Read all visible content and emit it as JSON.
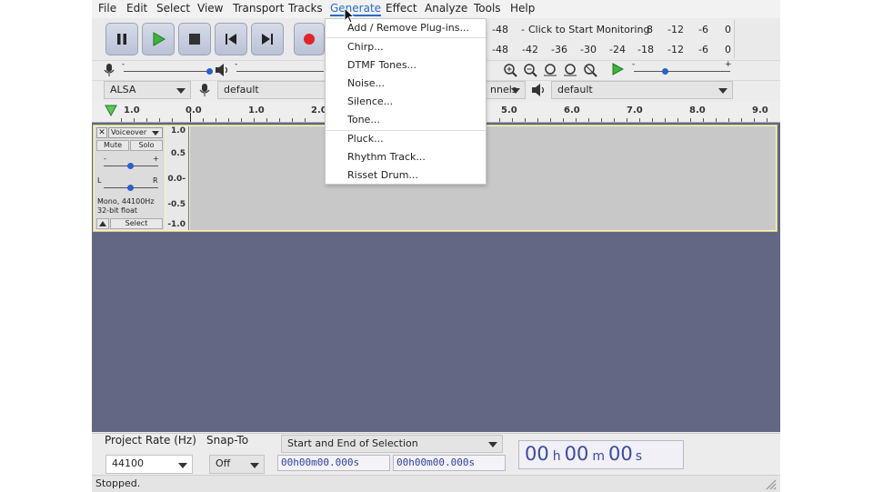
{
  "menubar": {
    "items": [
      "File",
      "Edit",
      "Select",
      "View",
      "Transport",
      "Tracks",
      "Generate",
      "Effect",
      "Analyze",
      "Tools",
      "Help"
    ],
    "active": "Generate"
  },
  "meters": {
    "record_scale": [
      "-48",
      "Click to Start Monitoring",
      "8",
      "-12",
      "-6",
      "0"
    ],
    "play_scale": [
      "-48",
      "-42",
      "-36",
      "-30",
      "-24",
      "-18",
      "-12",
      "-6",
      "0"
    ]
  },
  "device": {
    "host": "ALSA",
    "record_device": "default",
    "channels": "nnels",
    "playback_device": "default"
  },
  "ruler": {
    "labels": [
      "1.0",
      "0.0",
      "1.0",
      "2.0",
      "5.0",
      "6.0",
      "7.0",
      "8.0",
      "9.0"
    ]
  },
  "track": {
    "name": "Voiceover",
    "mute": "Mute",
    "solo": "Solo",
    "gain_min": "-",
    "gain_max": "+",
    "pan_left": "L",
    "pan_right": "R",
    "info_line1": "Mono, 44100Hz",
    "info_line2": "32-bit float",
    "select": "Select",
    "scale": [
      "1.0",
      "0.5",
      "0.0-",
      "-0.5",
      "-1.0"
    ]
  },
  "generate_menu": {
    "items": [
      "Add / Remove Plug-ins...",
      "Chirp...",
      "DTMF Tones...",
      "Noise...",
      "Silence...",
      "Tone...",
      "Pluck...",
      "Rhythm Track...",
      "Risset Drum..."
    ]
  },
  "bottom": {
    "project_rate_label": "Project Rate (Hz)",
    "project_rate_value": "44100",
    "snap_label": "Snap-To",
    "snap_value": "Off",
    "selection_mode": "Start and End of Selection",
    "sel_start": "00h00m00.000s",
    "sel_end": "00h00m00.000s",
    "time_h": "00",
    "time_h_unit": "h",
    "time_m": "00",
    "time_m_unit": "m",
    "time_s": "00",
    "time_s_unit": "s"
  },
  "status": {
    "text": "Stopped."
  },
  "colors": {
    "accent": "#2a6cc4",
    "track_bg": "#626784",
    "wave_bg": "#c8c8c8",
    "time_text": "#3d4aa0"
  }
}
